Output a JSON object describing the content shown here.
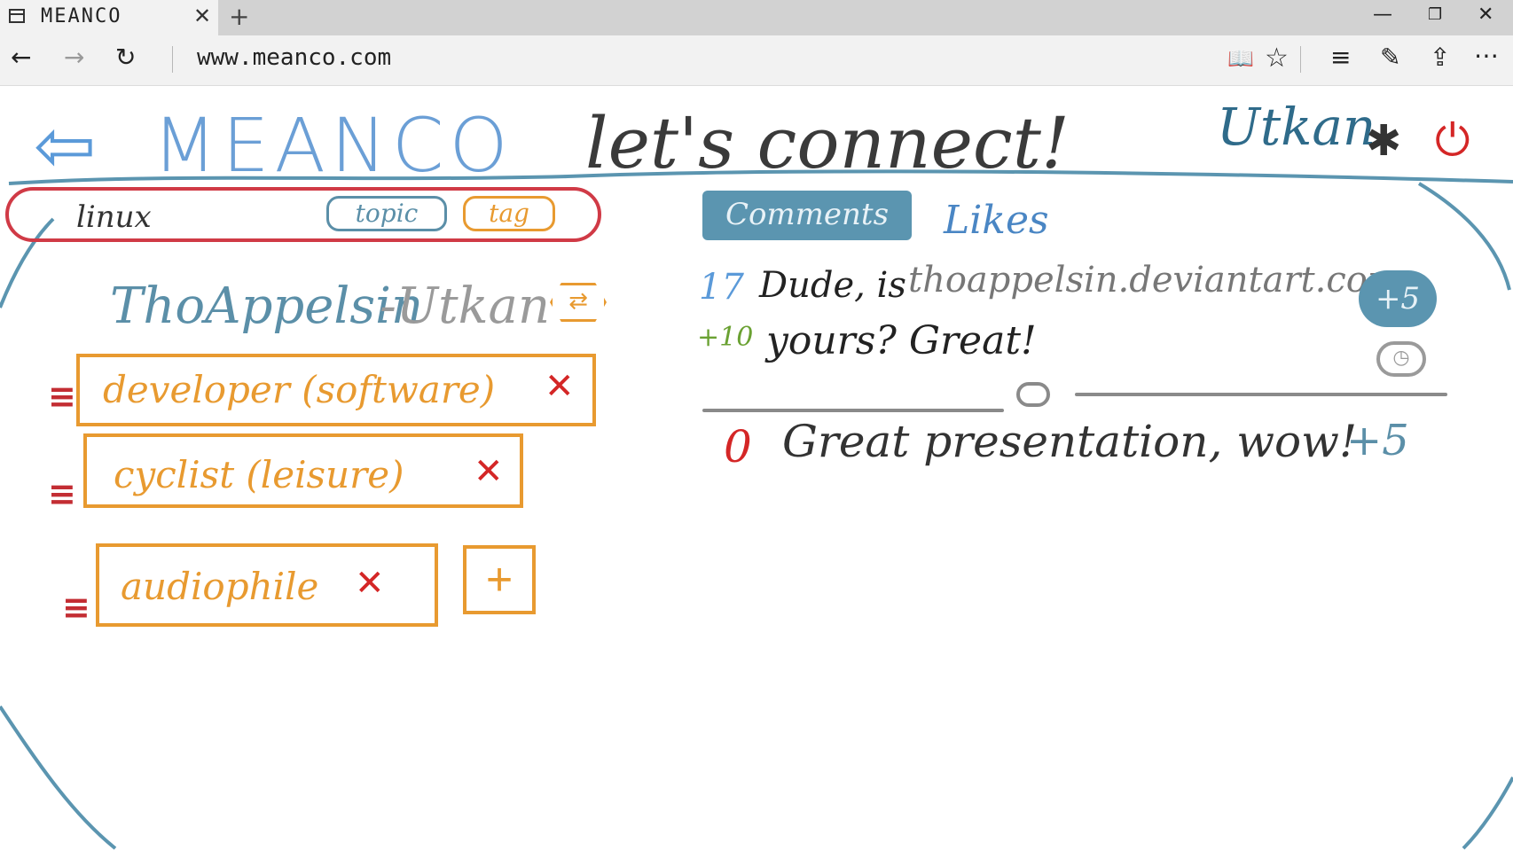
{
  "browser": {
    "tab_title": "MEANCO",
    "tab_close": "✕",
    "new_tab": "+",
    "address": "www.meanco.com",
    "window_min": "—",
    "window_restore": "❐",
    "window_close": "✕"
  },
  "nav": {
    "back_icon": "←",
    "forward_icon": "→",
    "refresh_icon": "↻",
    "reading_icon": "📖",
    "favorite_icon": "☆",
    "hub_icon": "≡",
    "note_icon": "✎",
    "share_icon": "⇪",
    "more_icon": "⋯"
  },
  "header": {
    "back_arrow": "⇦",
    "logo": "MEANCO",
    "slogan": "let's connect!",
    "username": "Utkan",
    "settings_icon": "✱",
    "power_icon": "⏻"
  },
  "search": {
    "value": "linux",
    "topic_label": "topic",
    "tag_label": "tag"
  },
  "profile": {
    "name": "ThoAppelsin",
    "separator_name": "-Utkan",
    "swap_icon": "⇄"
  },
  "tags": [
    {
      "handle": "≡",
      "label": "developer (software)",
      "remove": "✕"
    },
    {
      "handle": "≡",
      "label": "cyclist (leisure)",
      "remove": "✕"
    },
    {
      "handle": "≡",
      "label": "audiophile",
      "remove": "✕"
    }
  ],
  "add_tag": "+",
  "tabs": {
    "comments": "Comments",
    "likes": "Likes"
  },
  "comments": [
    {
      "count": "17",
      "text": "Dude, is",
      "link": "thoappelsin.deviantart.com",
      "delta": "+10",
      "text2": "yours? Great!",
      "plus_label": "+5",
      "clock_icon": "◷"
    },
    {
      "count": "0",
      "text": "Great presentation, wow!",
      "plus_label": "+5"
    }
  ],
  "colors": {
    "accent_blue": "#5b95b0",
    "logo_blue": "#6b9fd6",
    "tag_orange": "#e89a30",
    "search_red": "#d03a46",
    "remove_red": "#d42626",
    "delta_green": "#6aa132"
  }
}
